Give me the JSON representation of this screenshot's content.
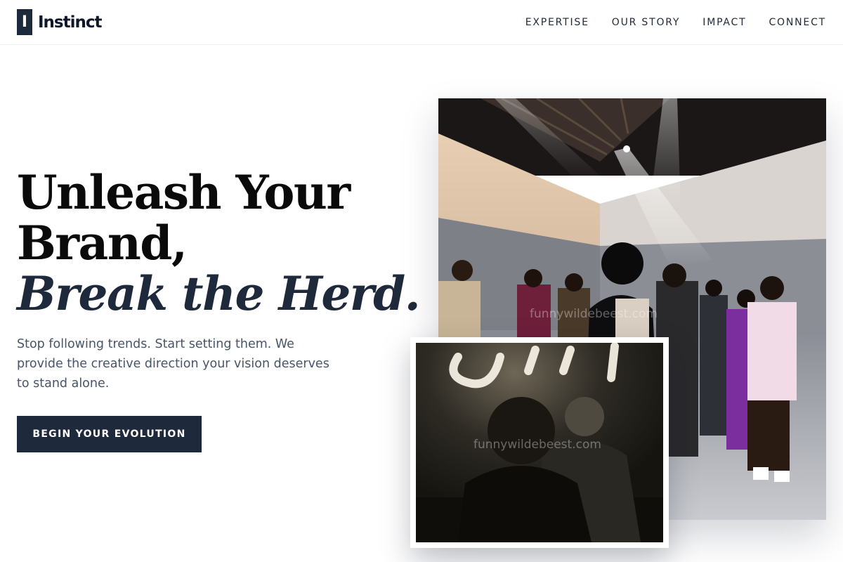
{
  "brand": {
    "mark": "I",
    "name": "Instinct"
  },
  "nav": [
    {
      "label": "EXPERTISE"
    },
    {
      "label": "OUR STORY"
    },
    {
      "label": "IMPACT"
    },
    {
      "label": "CONNECT"
    }
  ],
  "hero": {
    "headline_line1": "Unleash Your",
    "headline_line2": "Brand,",
    "headline_accent": "Break the Herd.",
    "subcopy": "Stop following trends. Start setting them. We provide the creative direction your vision deserves to stand alone.",
    "cta_label": "BEGIN YOUR EVOLUTION"
  },
  "images": {
    "main_watermark": "funnywildebeest.com",
    "inset_watermark": "funnywildebeest.com"
  },
  "colors": {
    "accent_navy": "#1e293b",
    "text_dark": "#0a0a0a",
    "text_muted": "#475569"
  }
}
